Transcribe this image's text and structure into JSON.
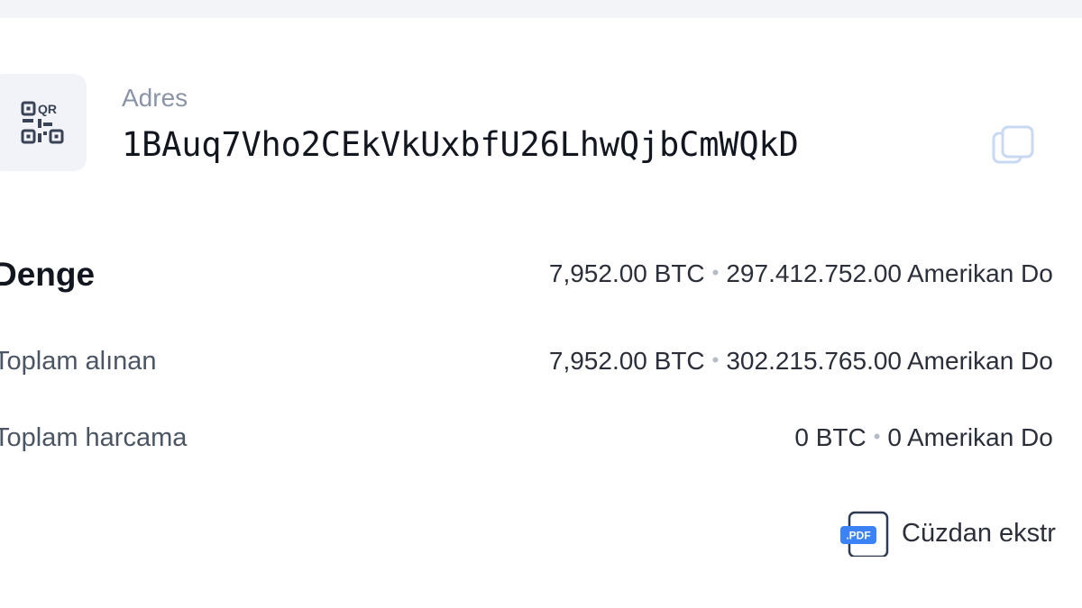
{
  "address": {
    "label": "Adres",
    "value": "1BAuq7Vho2CEkVkUxbfU26LhwQjbCmWQkD",
    "qr_icon": "qr-code-icon",
    "copy_icon": "copy-icon"
  },
  "rows": [
    {
      "label": "Denge",
      "btc": "7,952.00 BTC",
      "fiat_amount": "297.412.752.00",
      "fiat_currency": "Amerikan Do"
    },
    {
      "label": "Toplam alınan",
      "btc": "7,952.00 BTC",
      "fiat_amount": "302.215.765.00",
      "fiat_currency": "Amerikan Do"
    },
    {
      "label": "Toplam harcama",
      "btc": "0 BTC",
      "fiat_amount": "0",
      "fiat_currency": "Amerikan Do"
    }
  ],
  "statement": {
    "icon": "pdf-file-icon",
    "badge": ".PDF",
    "label": "Cüzdan ekstr"
  },
  "colors": {
    "accent": "#3b82f6",
    "muted": "#8a94a6",
    "text": "#12161f"
  }
}
